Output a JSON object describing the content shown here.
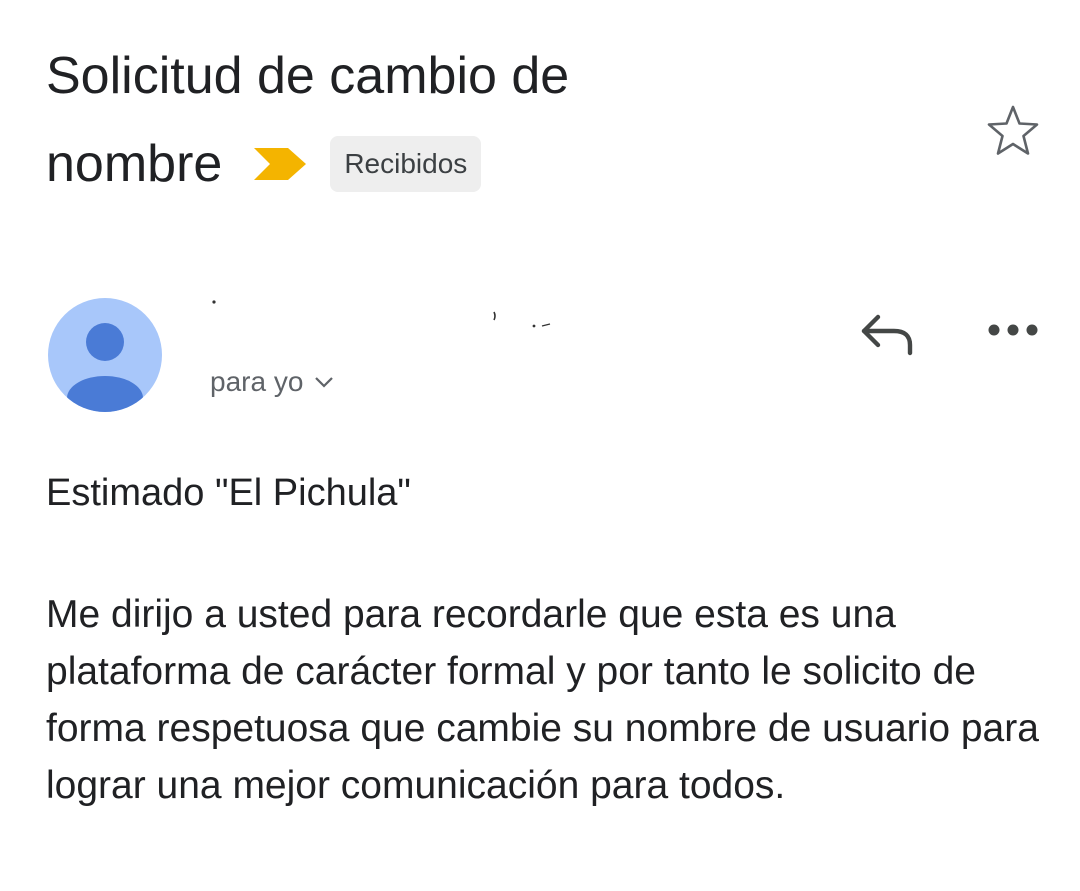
{
  "email": {
    "subject_line1": "Solicitud de cambio de",
    "subject_line2": "nombre",
    "label": "Recibidos",
    "sender_name": "",
    "to": "para yo",
    "greeting": "Estimado \"El Pichula\"",
    "body": "Me dirijo a usted para recordarle que esta es una plataforma de carácter formal y por tanto le solicito de forma respetuosa que cambie su nombre de usuario para lograr una mejor comunicación para todos."
  },
  "icons": {
    "label_marker": "label-importance-icon",
    "star": "star-outline-icon",
    "avatar": "person-avatar-icon",
    "reply": "reply-icon",
    "more": "more-horizontal-icon",
    "chevron": "chevron-down-icon"
  },
  "colors": {
    "importance": "#f4b400",
    "avatar_bg": "#a8c7fa",
    "avatar_fg": "#4a7bd6"
  }
}
